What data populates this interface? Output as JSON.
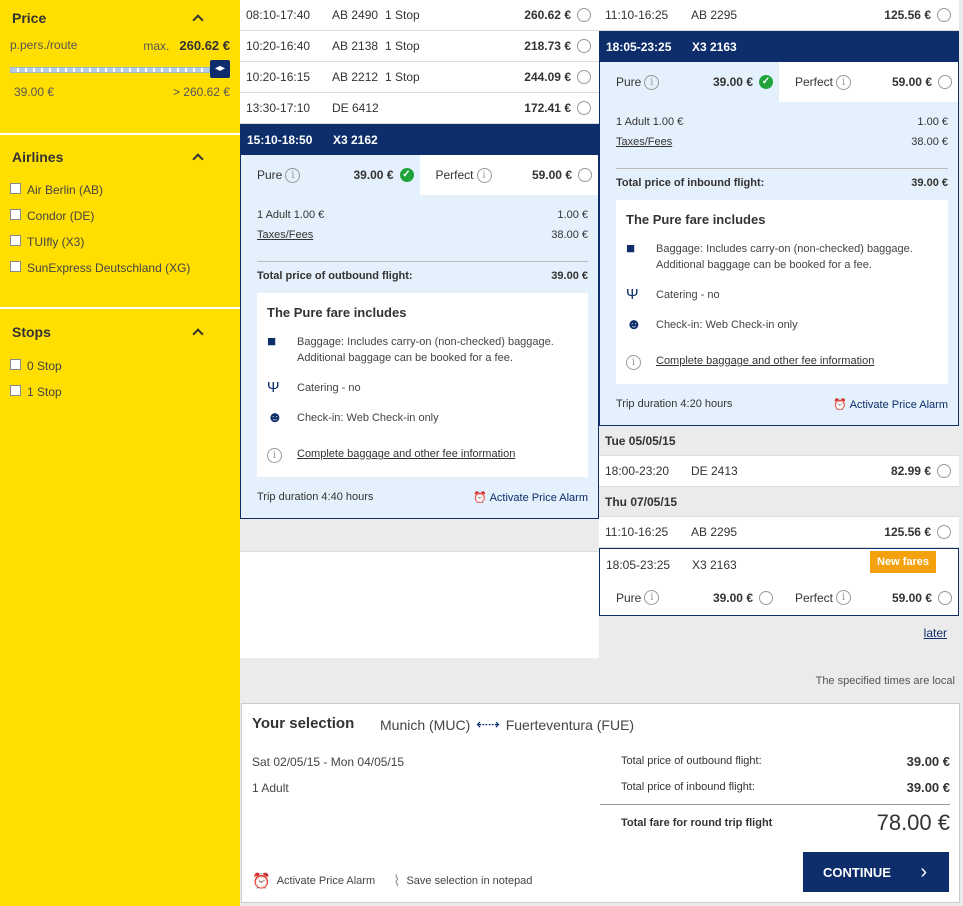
{
  "sidebar": {
    "price": {
      "title": "Price",
      "per_label": "p.pers./route",
      "max_label": "max.",
      "max_value": "260.62 €",
      "min_range": "39.00 €",
      "max_range": "> 260.62 €"
    },
    "airlines": {
      "title": "Airlines",
      "items": [
        "Air Berlin (AB)",
        "Condor (DE)",
        "TUIfly (X3)",
        "SunExpress Deutschland (XG)"
      ]
    },
    "stops": {
      "title": "Stops",
      "items": [
        "0 Stop",
        "1 Stop"
      ]
    }
  },
  "outbound": {
    "rows": [
      {
        "time": "08:10-17:40",
        "flight": "AB 2490",
        "stops": "1 Stop",
        "price": "260.62 €"
      },
      {
        "time": "10:20-16:40",
        "flight": "AB 2138",
        "stops": "1 Stop",
        "price": "218.73 €"
      },
      {
        "time": "10:20-16:15",
        "flight": "AB 2212",
        "stops": "1 Stop",
        "price": "244.09 €"
      },
      {
        "time": "13:30-17:10",
        "flight": "DE 6412",
        "stops": "",
        "price": "172.41 €"
      }
    ],
    "selected": {
      "time": "15:10-18:50",
      "flight": "X3 2162",
      "pure_label": "Pure",
      "pure_price": "39.00 €",
      "perfect_label": "Perfect",
      "perfect_price": "59.00 €",
      "adult_label": "1 Adult 1.00 €",
      "adult_value": "1.00 €",
      "taxes_label": "Taxes/Fees",
      "taxes_value": "38.00 €",
      "total_label": "Total price of outbound flight:",
      "total_value": "39.00 €",
      "includes_title": "The Pure fare includes",
      "baggage_text": "Baggage: Includes carry-on (non-checked) baggage. Additional baggage can be booked for a fee.",
      "catering_text": "Catering - no",
      "checkin_text": "Check-in: Web Check-in only",
      "fee_link": "Complete baggage and other fee information",
      "duration": "Trip duration 4:40  hours",
      "alarm": "Activate Price Alarm"
    }
  },
  "inbound": {
    "top_row": {
      "time": "11:10-16:25",
      "flight": "AB 2295",
      "price": "125.56 €"
    },
    "selected": {
      "time": "18:05-23:25",
      "flight": "X3 2163",
      "pure_label": "Pure",
      "pure_price": "39.00 €",
      "perfect_label": "Perfect",
      "perfect_price": "59.00 €",
      "adult_label": "1 Adult 1.00 €",
      "adult_value": "1.00 €",
      "taxes_label": "Taxes/Fees",
      "taxes_value": "38.00 €",
      "total_label": "Total price of inbound flight:",
      "total_value": "39.00 €",
      "includes_title": "The Pure fare includes",
      "baggage_text": "Baggage: Includes carry-on (non-checked) baggage. Additional baggage can be booked for a fee.",
      "catering_text": "Catering - no",
      "checkin_text": "Check-in: Web Check-in only",
      "fee_link": "Complete baggage and other fee information",
      "duration": "Trip duration 4:20  hours",
      "alarm": "Activate Price Alarm"
    },
    "date1": "Tue 05/05/15",
    "date1_row": {
      "time": "18:00-23:20",
      "flight": "DE 2413",
      "price": "82.99 €"
    },
    "date2": "Thu 07/05/15",
    "date2_row": {
      "time": "11:10-16:25",
      "flight": "AB 2295",
      "price": "125.56 €"
    },
    "date2_row2": {
      "time": "18:05-23:25",
      "flight": "X3 2163",
      "badge": "New fares",
      "pure_label": "Pure",
      "pure_price": "39.00 €",
      "perfect_label": "Perfect",
      "perfect_price": "59.00 €"
    },
    "later": "later"
  },
  "local_note": "The specified times are local",
  "selection": {
    "title": "Your selection",
    "from": "Munich (MUC)",
    "to": "Fuerteventura (FUE)",
    "dates": "Sat 02/05/15 - Mon 04/05/15",
    "pax": "1 Adult",
    "outbound_label": "Total price of outbound flight:",
    "outbound_value": "39.00 €",
    "inbound_label": "Total price of inbound flight:",
    "inbound_value": "39.00 €",
    "total_label": "Total fare for round trip flight",
    "total_value": "78.00 €",
    "alarm": "Activate Price Alarm",
    "notepad": "Save selection in notepad",
    "continue": "CONTINUE"
  },
  "colors": {
    "brand_yellow": "#ffde00",
    "navy": "#0d2d6b",
    "light_blue": "#e4f0fb",
    "orange": "#f4a10e",
    "green": "#21a33c"
  }
}
